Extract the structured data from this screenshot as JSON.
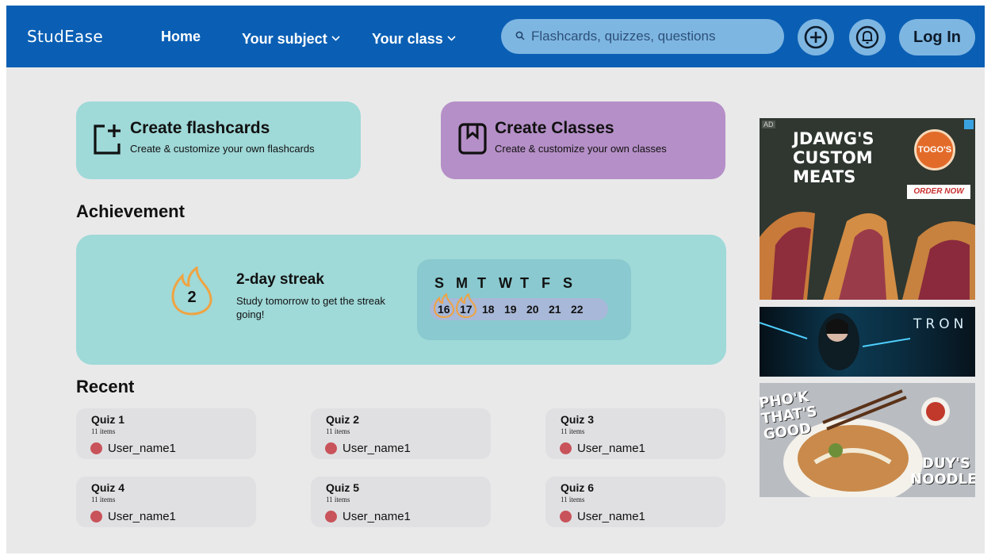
{
  "header": {
    "brand": "StudEase",
    "nav": {
      "home": "Home",
      "subject": "Your subject",
      "class": "Your class"
    },
    "search_placeholder": "Flashcards, quizzes, questions",
    "login": "Log In"
  },
  "create": {
    "flashcards": {
      "title": "Create flashcards",
      "subtitle": "Create & customize your own flashcards"
    },
    "classes": {
      "title": "Create Classes",
      "subtitle": "Create & customize your own classes"
    }
  },
  "achievement": {
    "heading": "Achievement",
    "streak_count": "2",
    "streak_title": "2-day streak",
    "streak_subtitle": "Study tomorrow to get the streak going!",
    "days": [
      "S",
      "M",
      "T",
      "W",
      "T",
      "F",
      "S"
    ],
    "dates": [
      "16",
      "17",
      "18",
      "19",
      "20",
      "21",
      "22"
    ],
    "active_dates": [
      "16",
      "17"
    ]
  },
  "recent": {
    "heading": "Recent",
    "quizzes": [
      {
        "title": "Quiz 1",
        "items": "11 items",
        "user": "User_name1"
      },
      {
        "title": "Quiz 2",
        "items": "11 items",
        "user": "User_name1"
      },
      {
        "title": "Quiz 3",
        "items": "11 items",
        "user": "User_name1"
      },
      {
        "title": "Quiz 4",
        "items": "11 items",
        "user": "User_name1"
      },
      {
        "title": "Quiz 5",
        "items": "11 items",
        "user": "User_name1"
      },
      {
        "title": "Quiz 6",
        "items": "11 items",
        "user": "User_name1"
      }
    ]
  },
  "ads": {
    "tag": "AD",
    "ad1": {
      "title": "JDAWG'S CUSTOM MEATS",
      "logo": "TOGO'S",
      "cta": "ORDER NOW"
    },
    "ad2": {
      "title": "TRON"
    },
    "ad3": {
      "title": "PHO'K THAT'S GOOD",
      "brand": "DUY'S NOODLES"
    }
  },
  "colors": {
    "header_bg": "#0a5fb4",
    "accent_light": "#7eb6e2",
    "teal_card": "#9fd9d8",
    "purple_card": "#b58fc7",
    "flame": "#f0a341",
    "user_dot": "#c9535a"
  }
}
